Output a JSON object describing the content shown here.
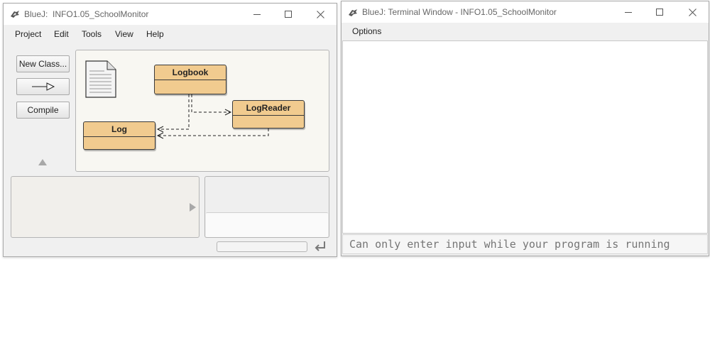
{
  "main_window": {
    "app_name": "BlueJ:",
    "project_name": "INFO1.05_SchoolMonitor",
    "menus": [
      "Project",
      "Edit",
      "Tools",
      "View",
      "Help"
    ],
    "buttons": {
      "new_class": "New Class...",
      "compile": "Compile"
    },
    "classes": {
      "logbook": "Logbook",
      "logreader": "LogReader",
      "log": "Log"
    }
  },
  "terminal_window": {
    "title": "BlueJ: Terminal Window - INFO1.05_SchoolMonitor",
    "menus": [
      "Options"
    ],
    "input_placeholder": "Can only enter input while your program is running"
  },
  "icons": {
    "app": "bluej-bird-icon",
    "minimize": "minimize-icon",
    "maximize": "maximize-icon",
    "close": "close-icon",
    "arrow": "inheritance-arrow-icon",
    "readme": "readme-document-icon",
    "expand": "triangle-up-icon",
    "expand_right": "triangle-right-icon",
    "reset": "return-arrow-icon"
  },
  "colors": {
    "class_fill": "#f1cb8f",
    "diagram_bg": "#f8f7f2",
    "window_bg": "#f0f0f0"
  }
}
